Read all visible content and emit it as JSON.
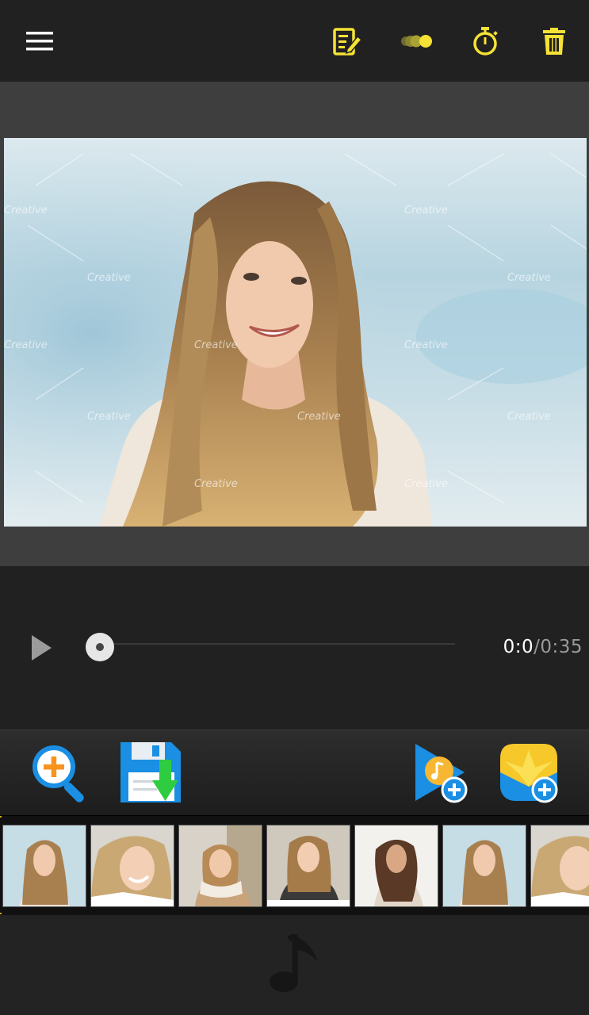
{
  "topbar": {
    "icons": [
      "menu-icon",
      "edit-text-icon",
      "transition-icon",
      "timer-icon",
      "delete-icon"
    ],
    "accent_color": "#f5e234"
  },
  "player": {
    "current_time": "0:0",
    "separator": "/",
    "total_time": "0:35",
    "progress": 0.0
  },
  "tools": {
    "icons": [
      "zoom-add-icon",
      "save-icon",
      "add-music-icon",
      "add-photos-icon"
    ]
  },
  "filmstrip": {
    "thumbnail_count": 7
  },
  "colors": {
    "accent_yellow": "#f5e234",
    "blue": "#1a8fe3",
    "orange": "#f7931e",
    "green": "#2ecc40"
  }
}
